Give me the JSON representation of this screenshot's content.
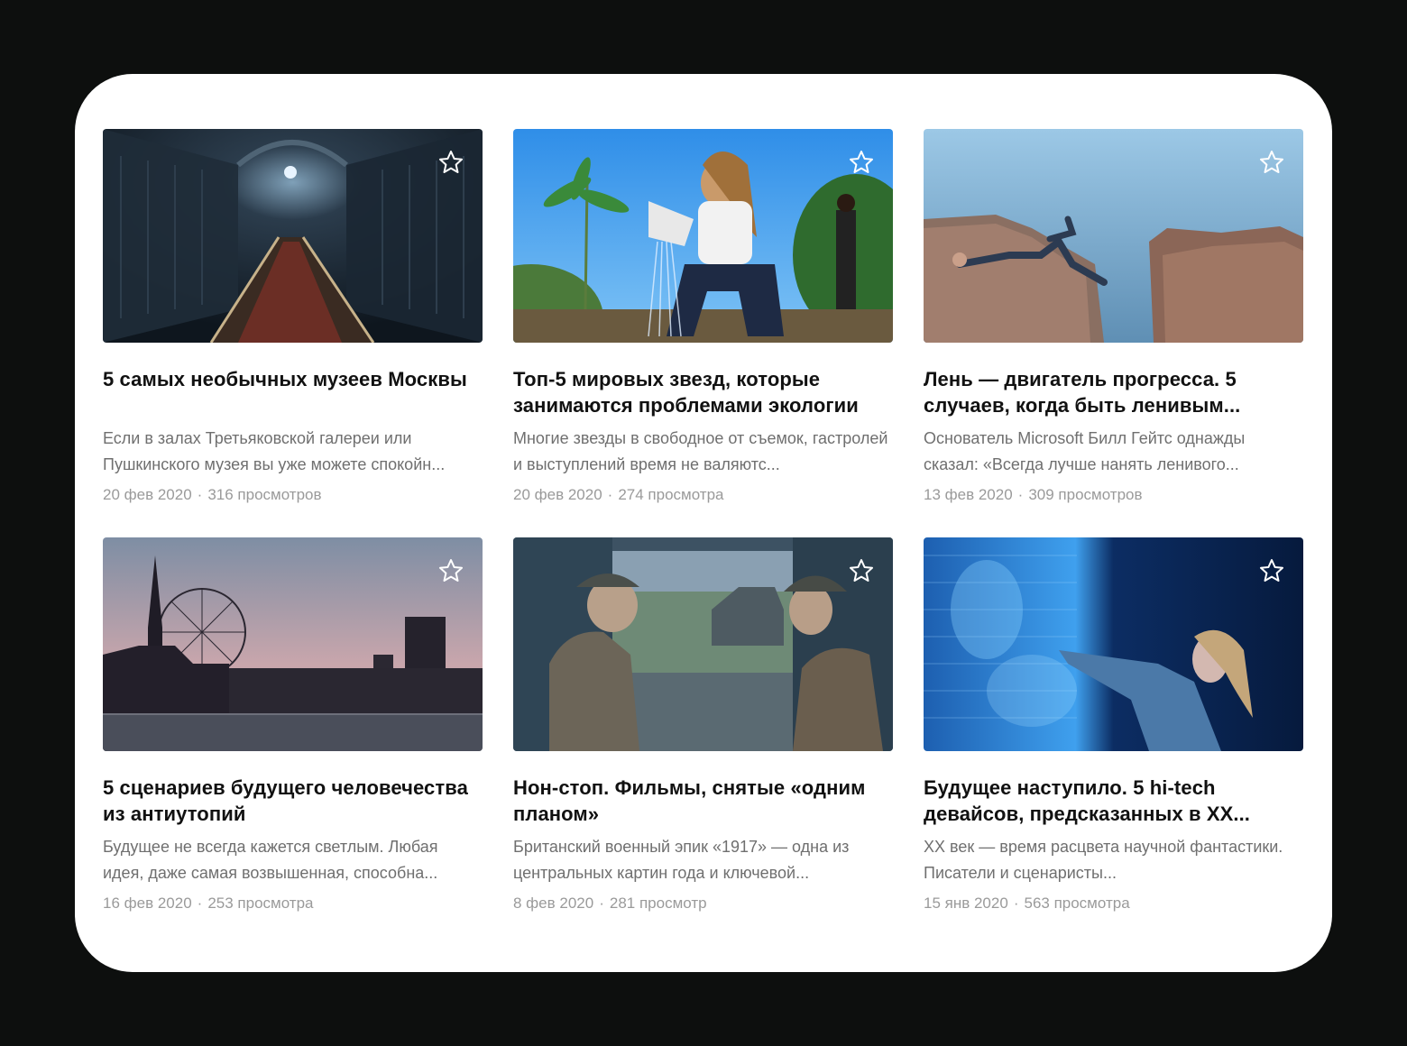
{
  "cards": [
    {
      "title": "5 самых необычных музеев Москвы",
      "description": "Если в залах Третьяковской галереи или Пушкинского музея вы уже можете спокойн...",
      "date": "20 фев 2020",
      "views": "316 просмотров",
      "icon": "star-icon"
    },
    {
      "title": "Топ-5 мировых звезд, которые занимаются проблемами экологии",
      "description": "Многие звезды в свободное от съемок, гастролей и выступлений время не валяютс...",
      "date": "20 фев 2020",
      "views": "274 просмотра",
      "icon": "star-icon"
    },
    {
      "title": "Лень — двигатель прогресса. 5 случаев, когда быть ленивым...",
      "description": "Основатель Microsoft Билл Гейтс однажды сказал: «Всегда лучше нанять ленивого...",
      "date": "13 фев 2020",
      "views": "309 просмотров",
      "icon": "star-icon"
    },
    {
      "title": "5 сценариев будущего человечества из антиутопий",
      "description": "Будущее не всегда кажется светлым. Любая идея, даже самая возвышенная, способна...",
      "date": "16 фев 2020",
      "views": "253 просмотра",
      "icon": "star-icon"
    },
    {
      "title": "Нон-стоп. Фильмы, снятые «одним планом»",
      "description": "Британский военный эпик «1917» — одна из центральных картин года и ключевой...",
      "date": "8 фев 2020",
      "views": "281 просмотр",
      "icon": "star-icon"
    },
    {
      "title": "Будущее наступило. 5 hi-tech девайсов, предсказанных в XX...",
      "description": "XX век — время расцвета научной фантастики. Писатели и сценаристы...",
      "date": "15 янв 2020",
      "views": "563 просмотра",
      "icon": "star-icon"
    }
  ],
  "meta_separator": "·",
  "colors": {
    "background": "#0d0f0e",
    "panel": "#ffffff",
    "title": "#111111",
    "description": "#6f6f6f",
    "meta": "#9a9a9a"
  }
}
